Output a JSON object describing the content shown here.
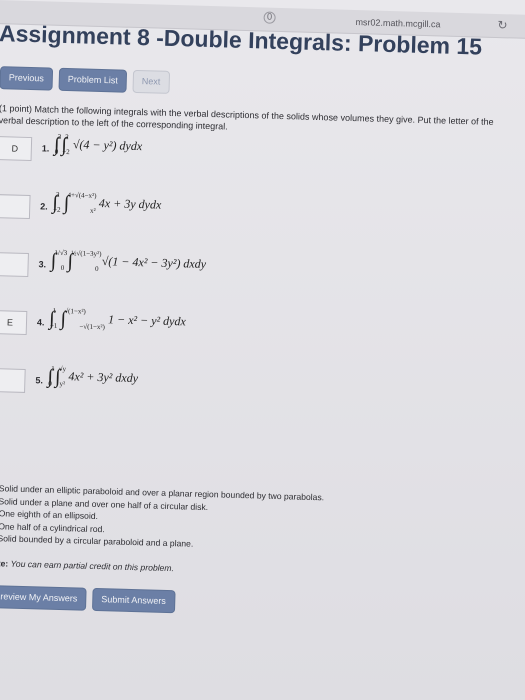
{
  "browser": {
    "tab_icon": "0",
    "url": "msr02.math.mcgill.ca",
    "reload_icon": "reload-icon"
  },
  "page": {
    "title": "Assignment 8 -Double Integrals: Problem 15"
  },
  "nav": {
    "previous": "Previous",
    "problem_list": "Problem List",
    "next": "Next"
  },
  "prompt": "(1 point) Match the following integrals with the verbal descriptions of the solids whose volumes they give. Put the letter of the verbal description to the left of the corresponding integral.",
  "items": [
    {
      "answer": "D",
      "num": "1.",
      "integrand": "√(4 − y²) dydx",
      "lims": [
        "0",
        "2",
        "−2",
        "2"
      ]
    },
    {
      "answer": "",
      "num": "2.",
      "integrand": "4x + 3y dydx",
      "lims": [
        "−2",
        "2",
        "x²",
        "4+√(4−x²)"
      ]
    },
    {
      "answer": "",
      "num": "3.",
      "integrand": "√(1 − 4x² − 3y²) dxdy",
      "lims": [
        "0",
        "1/√3",
        "0",
        "½√(1−3y²)"
      ]
    },
    {
      "answer": "E",
      "num": "4.",
      "integrand": "1 − x² − y² dydx",
      "lims": [
        "−1",
        "1",
        "−√(1−x²)",
        "√(1−x²)"
      ]
    },
    {
      "answer": "",
      "num": "5.",
      "integrand": "4x² + 3y² dxdy",
      "lims": [
        "0",
        "1",
        "y²",
        "√y"
      ]
    }
  ],
  "descriptions": [
    "A. Solid under an elliptic paraboloid and over a planar region bounded by two parabolas.",
    "B. Solid under a plane and over one half of a circular disk.",
    "C. One eighth of an ellipsoid.",
    "D. One half of a cylindrical rod.",
    "E. Solid bounded by a circular paraboloid and a plane."
  ],
  "note": {
    "label": "Note:",
    "text": "You can earn partial credit on this problem."
  },
  "actions": {
    "preview": "Preview My Answers",
    "submit": "Submit Answers"
  }
}
